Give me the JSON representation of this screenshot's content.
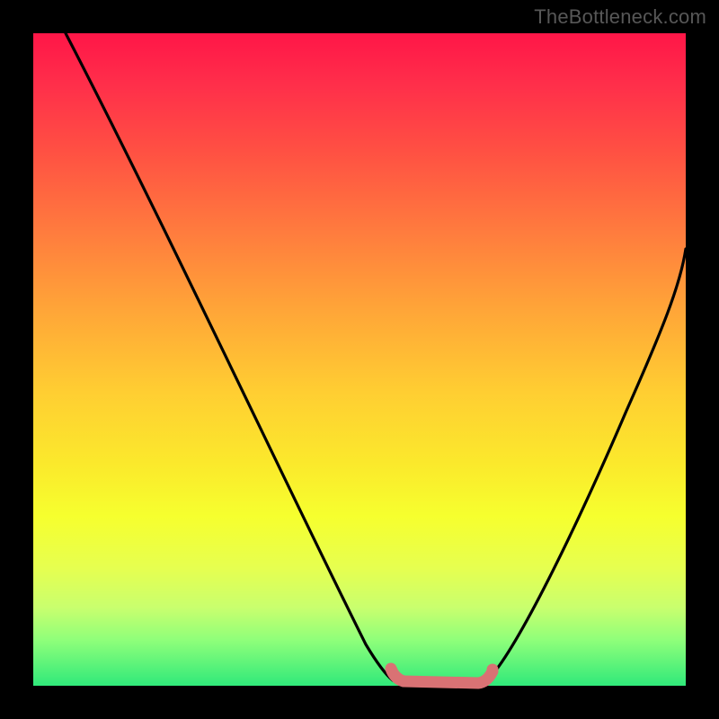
{
  "watermark": "TheBottleneck.com",
  "chart_data": {
    "type": "line",
    "title": "",
    "xlabel": "",
    "ylabel": "",
    "xlim": [
      0,
      100
    ],
    "ylim": [
      0,
      100
    ],
    "grid": false,
    "series": [
      {
        "name": "left-curve",
        "color": "#000000",
        "x": [
          5,
          10,
          15,
          20,
          25,
          30,
          35,
          40,
          45,
          50,
          53,
          55
        ],
        "values": [
          100,
          90,
          80,
          70,
          60,
          49,
          38,
          27,
          17,
          8,
          4,
          2
        ]
      },
      {
        "name": "right-curve",
        "color": "#000000",
        "x": [
          70,
          72,
          75,
          78,
          81,
          84,
          87,
          90,
          93,
          96,
          100
        ],
        "values": [
          2,
          4,
          8,
          13,
          19,
          26,
          33,
          40,
          48,
          56,
          67
        ]
      },
      {
        "name": "bottom-band",
        "color": "#d86a6a",
        "x": [
          55,
          57,
          59,
          61,
          63,
          65,
          67,
          69,
          70
        ],
        "values": [
          2.2,
          1.0,
          0.6,
          0.5,
          0.5,
          0.6,
          1.0,
          1.8,
          2.4
        ]
      }
    ],
    "annotations": [
      {
        "text": "TheBottleneck.com",
        "position": "top-right"
      }
    ]
  }
}
